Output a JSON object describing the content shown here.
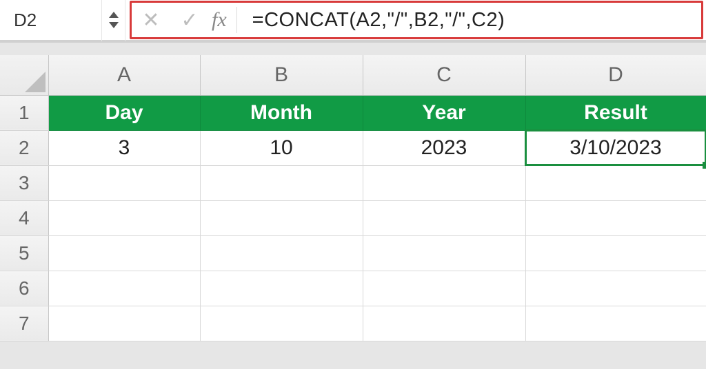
{
  "formula_bar": {
    "cell_ref": "D2",
    "formula": "=CONCAT(A2,\"/\",B2,\"/\",C2)",
    "fx_label": "fx"
  },
  "columns": [
    "A",
    "B",
    "C",
    "D"
  ],
  "row_nums": [
    "1",
    "2",
    "3",
    "4",
    "5",
    "6",
    "7"
  ],
  "headers": {
    "A": "Day",
    "B": "Month",
    "C": "Year",
    "D": "Result"
  },
  "data_row": {
    "A": "3",
    "B": "10",
    "C": "2023",
    "D": "3/10/2023"
  },
  "selected_cell": "D2",
  "chart_data": {
    "type": "table",
    "title": "",
    "columns": [
      "Day",
      "Month",
      "Year",
      "Result"
    ],
    "rows": [
      {
        "Day": 3,
        "Month": 10,
        "Year": 2023,
        "Result": "3/10/2023"
      }
    ]
  }
}
